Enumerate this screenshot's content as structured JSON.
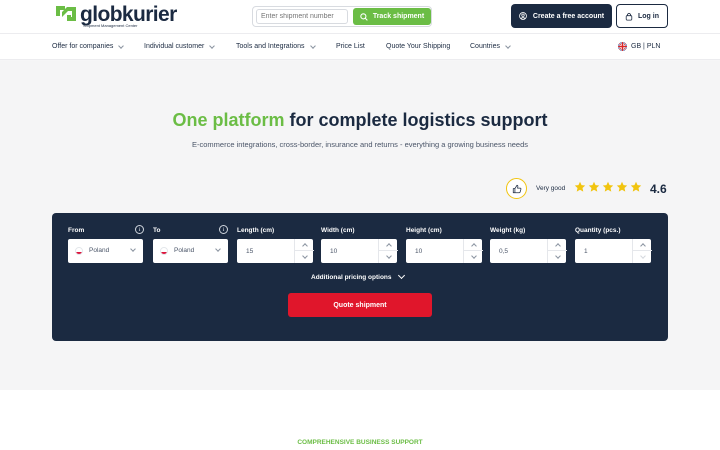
{
  "brand": {
    "name": "globkurier",
    "tagline": "Shipment Management Center",
    "colors": {
      "green": "#6bbd45",
      "navy": "#1b2a41",
      "red": "#e0162b",
      "star": "#f1c40f"
    }
  },
  "header": {
    "search_placeholder": "Enter shipment number",
    "track_label": "Track shipment",
    "create_label": "Create a free account",
    "login_label": "Log in"
  },
  "nav": {
    "items": [
      {
        "label": "Offer for companies",
        "has_dropdown": true
      },
      {
        "label": "Individual customer",
        "has_dropdown": true
      },
      {
        "label": "Tools and Integrations",
        "has_dropdown": true
      },
      {
        "label": "Price List",
        "has_dropdown": false
      },
      {
        "label": "Quote Your Shipping",
        "has_dropdown": false
      },
      {
        "label": "Countries",
        "has_dropdown": true
      }
    ],
    "locale": "GB | PLN"
  },
  "hero": {
    "title_highlight": "One platform",
    "title_rest": " for complete logistics support",
    "subtitle": "E-commerce integrations, cross-border, insurance and returns - everything a growing business needs"
  },
  "rating": {
    "label": "Very good",
    "value": "4.6",
    "stars_max": 5,
    "stars_filled": 5
  },
  "quote_form": {
    "from": {
      "label": "From",
      "value": "Poland"
    },
    "to": {
      "label": "To",
      "value": "Poland"
    },
    "length": {
      "label": "Length (cm)",
      "value": "15"
    },
    "width": {
      "label": "Width (cm)",
      "value": "10"
    },
    "height": {
      "label": "Height (cm)",
      "value": "10"
    },
    "weight": {
      "label": "Weight (kg)",
      "value": "0,5"
    },
    "quantity": {
      "label": "Quantity (pcs.)",
      "value": "1"
    },
    "additional_label": "Additional pricing options",
    "submit_label": "Quote shipment"
  },
  "section": {
    "label": "COMPREHENSIVE BUSINESS SUPPORT"
  }
}
